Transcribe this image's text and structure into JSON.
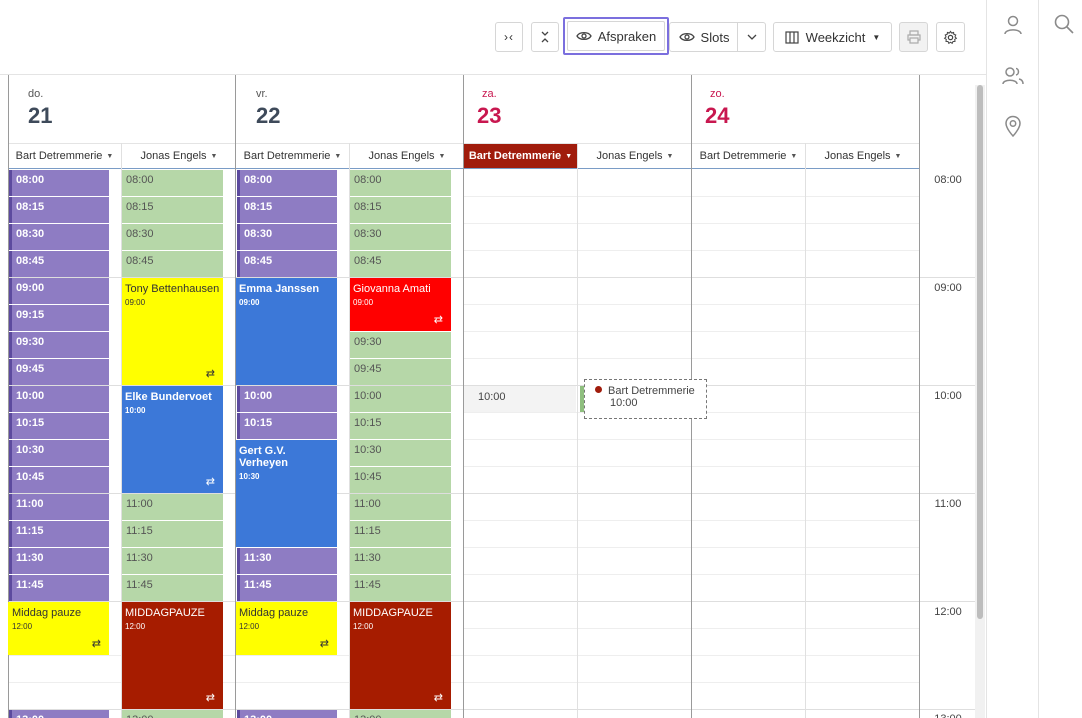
{
  "toolbar": {
    "collapse_label": "›‹",
    "expand_label": "⌄⌃",
    "appointments_label": "Afspraken",
    "slots_label": "Slots",
    "view_label": "Weekzicht",
    "colors": {
      "active_outline": "#7b6fde"
    }
  },
  "days": [
    {
      "name": "do.",
      "num": "21",
      "weekend": false
    },
    {
      "name": "vr.",
      "num": "22",
      "weekend": false
    },
    {
      "name": "za.",
      "num": "23",
      "weekend": true
    },
    {
      "name": "zo.",
      "num": "24",
      "weekend": true
    }
  ],
  "resources": {
    "bart": "Bart Detremmerie",
    "jonas": "Jonas Engels"
  },
  "times": {
    "t0800": "08:00",
    "t0815": "08:15",
    "t0830": "08:30",
    "t0845": "08:45",
    "t0900": "09:00",
    "t0915": "09:15",
    "t0930": "09:30",
    "t0945": "09:45",
    "t1000": "10:00",
    "t1015": "10:15",
    "t1030": "10:30",
    "t1045": "10:45",
    "t1100": "11:00",
    "t1115": "11:15",
    "t1130": "11:30",
    "t1145": "11:45",
    "t1200": "12:00",
    "t1300": "13:00"
  },
  "appointments": {
    "tony": {
      "title": "Tony Bettenhausen",
      "time": "09:00"
    },
    "elke": {
      "title": "Elke Bundervoet",
      "time": "10:00"
    },
    "emma": {
      "title": "Emma Janssen",
      "time": "09:00"
    },
    "gert": {
      "title": "Gert G.V. Verheyen",
      "time": "10:30"
    },
    "giovanna": {
      "title": "Giovanna Amati",
      "time": "09:00"
    },
    "middag": {
      "title": "Middag pauze",
      "time": "12:00"
    },
    "middagpauze": {
      "title": "MIDDAGPAUZE",
      "time": "12:00"
    },
    "repeat_symbol": "⇄"
  },
  "drag": {
    "slot_time": "10:00",
    "tooltip_name": "Bart Detremmerie",
    "tooltip_time": "10:00"
  },
  "colors": {
    "slot_purple": "#8e7cc3",
    "slot_green": "#b6d7a8",
    "appt_yellow": "#ffff00",
    "appt_blue": "#3c78d8",
    "appt_red": "#ff0000",
    "appt_darkred": "#a61c00",
    "weekend_text": "#c8174f"
  },
  "icons": [
    "eye-icon",
    "chevron-down-icon",
    "columns-icon",
    "print-icon",
    "settings-icon",
    "user-icon",
    "users-icon",
    "location-pin-icon",
    "search-icon"
  ]
}
